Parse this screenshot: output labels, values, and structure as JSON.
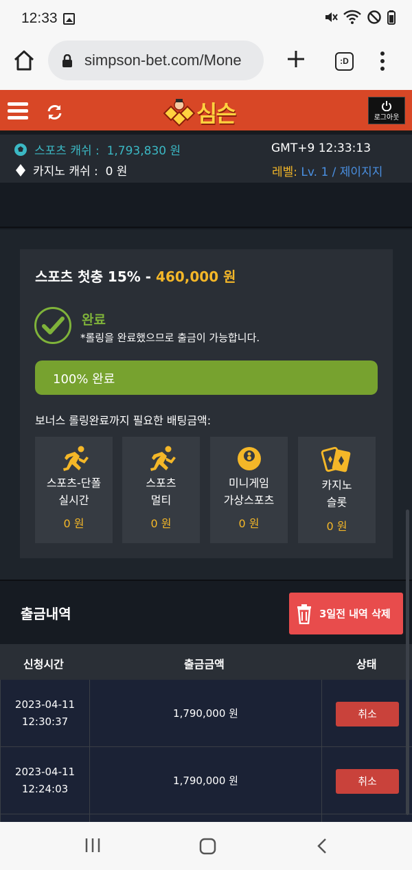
{
  "status_bar": {
    "time": "12:33"
  },
  "browser": {
    "url": "simpson-bet.com/Mone",
    "tabs_label": ":D"
  },
  "site": {
    "logo_text": "심슨",
    "logout_label": "로그아웃"
  },
  "info": {
    "sports_cash_label": "스포츠 캐쉬 :",
    "sports_cash_value": "1,793,830 원",
    "casino_cash_label": "카지노 캐쉬 :",
    "casino_cash_value": "0 원",
    "clock": "GMT+9 12:33:13",
    "level_label": "레벨:",
    "level_value": "Lv. 1 / 제이지지"
  },
  "bonus": {
    "title": "스포츠 첫충 15% - ",
    "amount": "460,000 원",
    "status_title": "완료",
    "status_note": "*롤링을 완료했으므로 출금이 가능합니다.",
    "progress_percent": 100,
    "progress_label": "100% 완료",
    "needed_label": "보너스 롤링완료까지 필요한 배팅금액:",
    "tiles": [
      {
        "line1": "스포츠-단폴",
        "line2": "실시간",
        "value": "0 원",
        "icon": "running-icon"
      },
      {
        "line1": "스포츠",
        "line2": "멀티",
        "value": "0 원",
        "icon": "running-icon"
      },
      {
        "line1": "미니게임",
        "line2": "가상스포츠",
        "value": "0 원",
        "icon": "eight-ball-icon"
      },
      {
        "line1": "카지노",
        "line2": "슬롯",
        "value": "0 원",
        "icon": "cards-icon"
      }
    ]
  },
  "withdrawals": {
    "title": "출금내역",
    "delete_label": "3일전 내역 삭제",
    "headers": [
      "신청시간",
      "출금금액",
      "상태"
    ],
    "rows": [
      {
        "date": "2023-04-11",
        "time": "12:30:37",
        "amount": "1,790,000 원",
        "action": "취소"
      },
      {
        "date": "2023-04-11",
        "time": "12:24:03",
        "amount": "1,790,000 원",
        "action": "취소"
      }
    ]
  },
  "colors": {
    "header": "#d84726",
    "accent_gold": "#f4b728",
    "success_green": "#77a22f",
    "cancel_red": "#c9423b",
    "delete_red": "#e84c4c",
    "sports_cash_teal": "#3bb8c4",
    "level_blue": "#4a90e2"
  }
}
